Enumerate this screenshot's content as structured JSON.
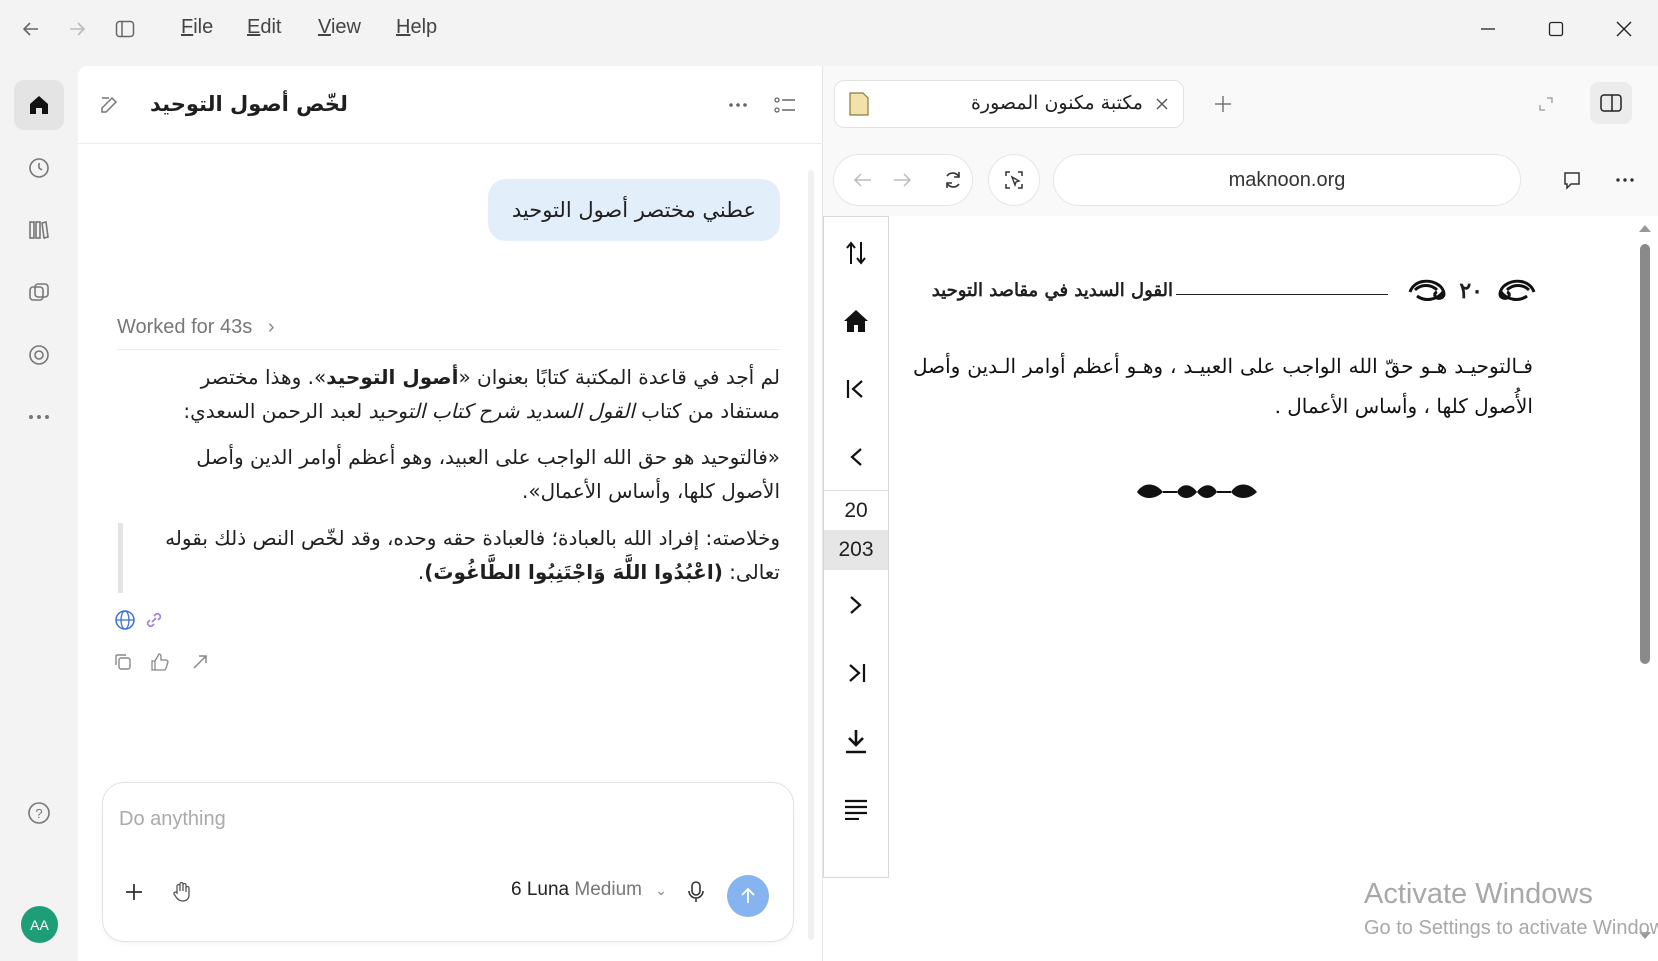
{
  "titlebar": {
    "menus": [
      "File",
      "Edit",
      "View",
      "Help"
    ],
    "menu_underline": [
      "F",
      "E",
      "V",
      "H"
    ],
    "menu_rest": [
      "ile",
      "dit",
      "iew",
      "elp"
    ]
  },
  "rail": {
    "items": [
      "home-icon",
      "history-icon",
      "library-icon",
      "agents-icon",
      "explore-icon",
      "more-icon"
    ],
    "help": "help-icon",
    "avatar_initials": "AA",
    "avatar_color": "#1e9e77"
  },
  "chat": {
    "title": "لخّص أصول التوحيد",
    "user_message": "عطني مختصر أصول التوحيد",
    "worked_label": "Worked for 43s",
    "answer_p1_a": "لم أجد في قاعدة المكتبة كتابًا بعنوان «",
    "answer_p1_bold": "أصول التوحيد",
    "answer_p1_b": "». وهذا مختصر مستفاد من كتاب ",
    "answer_p1_italic": "القول السديد شرح كتاب التوحيد",
    "answer_p1_c": " لعبد الرحمن السعدي:",
    "quote": "«فالتوحيد هو حق الله الواجب على العبيد، وهو أعظم أوامر الدين وأصل الأصول كلها، وأساس الأعمال».",
    "answer_p2_a": "وخلاصته: إفراد الله بالعبادة؛ فالعبادة حقه وحده، وقد لخّص النص ذلك بقوله تعالى: ",
    "answer_p2_bold": "(اعْبُدُوا اللَّهَ وَاجْتَنِبُوا الطَّاغُوتَ)",
    "answer_p2_end": ".",
    "composer_placeholder": "Do anything",
    "model_name": "6 Luna",
    "model_effort": "Medium",
    "accent": "#85b4f0"
  },
  "browser": {
    "tab_title": "مكتبة مكنون المصورة",
    "url": "maknoon.org",
    "pdf": {
      "current_page": "20",
      "total_pages": "203",
      "header_title": "القول السديد في مقاصد التوحيد",
      "header_page": "٢٠",
      "body": "فـالتوحيـد هـو حقّ الله الواجب على العبيـد ، وهـو أعظم أوامر الـدين وأصل الأُصول كلها ، وأساس الأعمال ."
    }
  },
  "watermark": {
    "line1": "Activate Windows",
    "line2": "Go to Settings to activate Windows."
  }
}
